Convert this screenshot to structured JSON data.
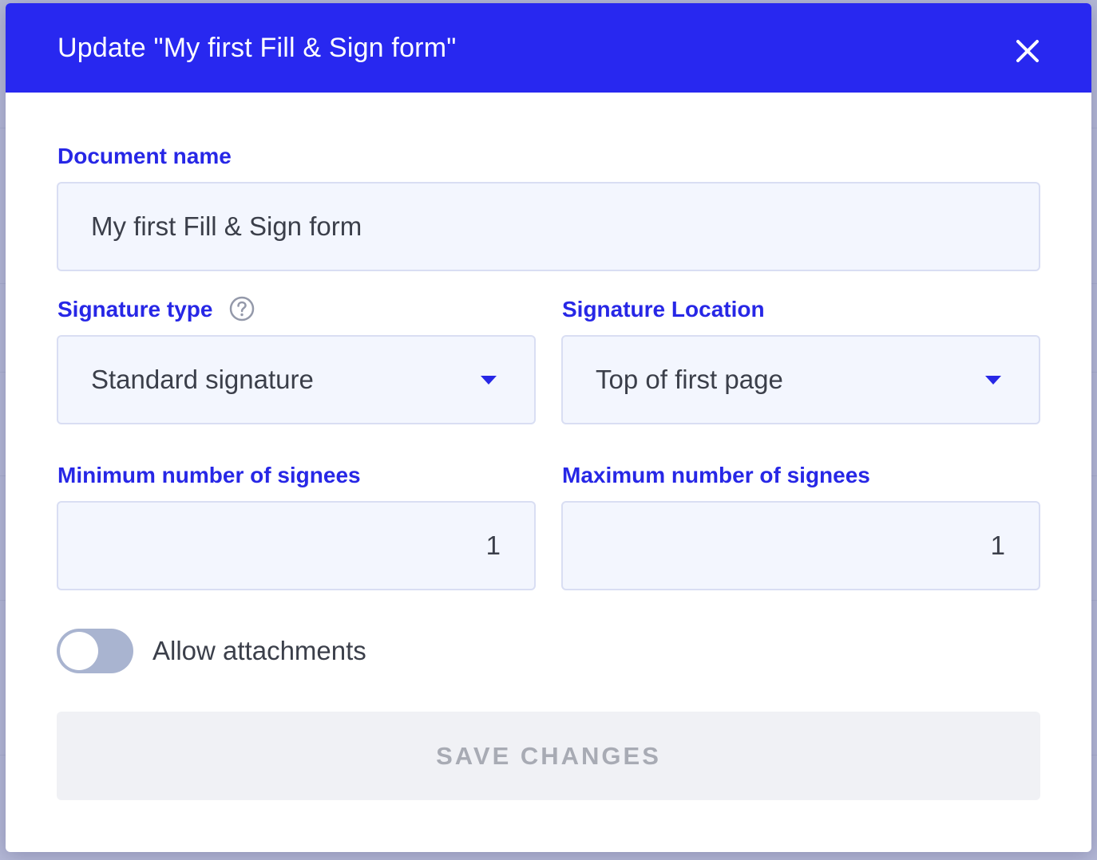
{
  "dialog": {
    "title": "Update \"My first Fill & Sign form\"",
    "close_icon": "close-icon"
  },
  "fields": {
    "document_name": {
      "label": "Document name",
      "value": "My first Fill & Sign form"
    },
    "signature_type": {
      "label": "Signature type",
      "value": "Standard signature",
      "help_icon": "question-circle-icon"
    },
    "signature_location": {
      "label": "Signature Location",
      "value": "Top of first page"
    },
    "min_signees": {
      "label": "Minimum number of signees",
      "value": "1"
    },
    "max_signees": {
      "label": "Maximum number of signees",
      "value": "1"
    }
  },
  "attachments_toggle": {
    "label": "Allow attachments",
    "enabled": false
  },
  "save_button": {
    "label": "SAVE CHANGES",
    "disabled": true
  },
  "colors": {
    "accent": "#2828f0",
    "label": "#2727e6",
    "input_bg": "#f3f6fe",
    "input_border": "#d9def3",
    "toggle_off": "#a9b4d0",
    "button_disabled_bg": "#f0f1f5",
    "button_disabled_text": "#a8abb4"
  }
}
